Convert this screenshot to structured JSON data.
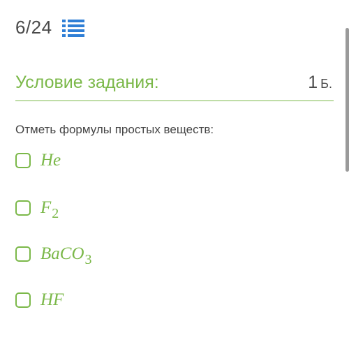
{
  "counter": {
    "text": "6/24",
    "icon": "list-icon"
  },
  "header": {
    "title": "Условие задания:",
    "points_value": "1",
    "points_unit": "Б."
  },
  "question": "Отметь формулы простых веществ:",
  "options": [
    {
      "main": "He",
      "sub": ""
    },
    {
      "main": "F",
      "sub": "2"
    },
    {
      "main": "BaCO",
      "sub": "3"
    },
    {
      "main": "HF",
      "sub": ""
    }
  ],
  "colors": {
    "accent": "#7bb849",
    "text": "#444444",
    "scrollbar": "#9a9a9a"
  }
}
